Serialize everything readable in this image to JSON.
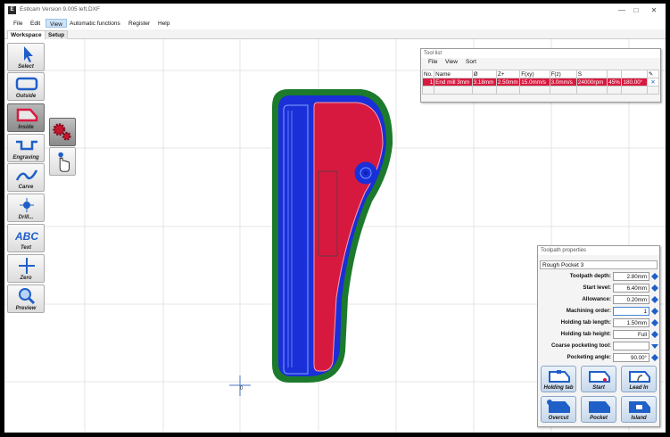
{
  "window": {
    "app_icon": "E",
    "title": "Estlcam Version 9.005 left.DXF",
    "minimize": "—",
    "maximize": "□",
    "close": "✕"
  },
  "menu": [
    "File",
    "Edit",
    "View",
    "Automatic functions",
    "Register",
    "Help"
  ],
  "menu_active": "View",
  "tabs": [
    "Workspace",
    "Setup"
  ],
  "tools": [
    {
      "label": "Select",
      "icon": "cursor-arrow-icon",
      "selected": false
    },
    {
      "label": "Outside",
      "icon": "outside-contour-icon",
      "selected": false
    },
    {
      "label": "Inside",
      "icon": "inside-contour-icon",
      "selected": true
    },
    {
      "label": "Engraving",
      "icon": "engraving-icon",
      "selected": false
    },
    {
      "label": "Carve",
      "icon": "carve-icon",
      "selected": false
    },
    {
      "label": "Drill...",
      "icon": "drill-icon",
      "selected": false
    },
    {
      "label": "Text",
      "icon": "text-abc-icon",
      "selected": false
    },
    {
      "label": "Zero",
      "icon": "zero-crosshair-icon",
      "selected": false
    },
    {
      "label": "Preview",
      "icon": "magnifier-icon",
      "selected": false
    }
  ],
  "subtools": [
    {
      "icon": "gears-icon"
    },
    {
      "icon": "hand-pointer-icon"
    }
  ],
  "origin_label": "0",
  "colors": {
    "part_fill_red": "#d8193f",
    "part_fill_blue": "#1a2fd8",
    "outer_green": "#1c7a2c",
    "accent_blue": "#1f5fc8",
    "selection_red": "#d8193f"
  },
  "tool_list": {
    "title": "Tool list",
    "menu": [
      "File",
      "View",
      "Sort"
    ],
    "headers": [
      "No.",
      "Name",
      "Ø",
      "Z+",
      "F(xy)",
      "F(z)",
      "S",
      "",
      ""
    ],
    "rows": [
      [
        "1",
        "End mill 3mm",
        "3.18mm",
        "2.50mm",
        "15.0mm/s",
        "3.0mm/s",
        "24000rpm",
        "45%",
        "180.00°"
      ]
    ]
  },
  "toolpath_props": {
    "title": "Toolpath properties",
    "name": "Rough Pocket 3",
    "fields": [
      {
        "label": "Toolpath depth:",
        "value": "2.80mm"
      },
      {
        "label": "Start level:",
        "value": "6.40mm"
      },
      {
        "label": "Allowance:",
        "value": "0.20mm"
      },
      {
        "label": "Machining order:",
        "value": "1"
      },
      {
        "label": "Holding tab length:",
        "value": "1.50mm"
      },
      {
        "label": "Holding tab height:",
        "value": "Full"
      },
      {
        "label": "Coarse pocketing tool:",
        "value": ""
      },
      {
        "label": "Pocketing angle:",
        "value": "90.00°"
      }
    ],
    "buttons": [
      "Holding tab",
      "Start",
      "Lead In",
      "Overcut",
      "Pocket",
      "Island"
    ]
  }
}
